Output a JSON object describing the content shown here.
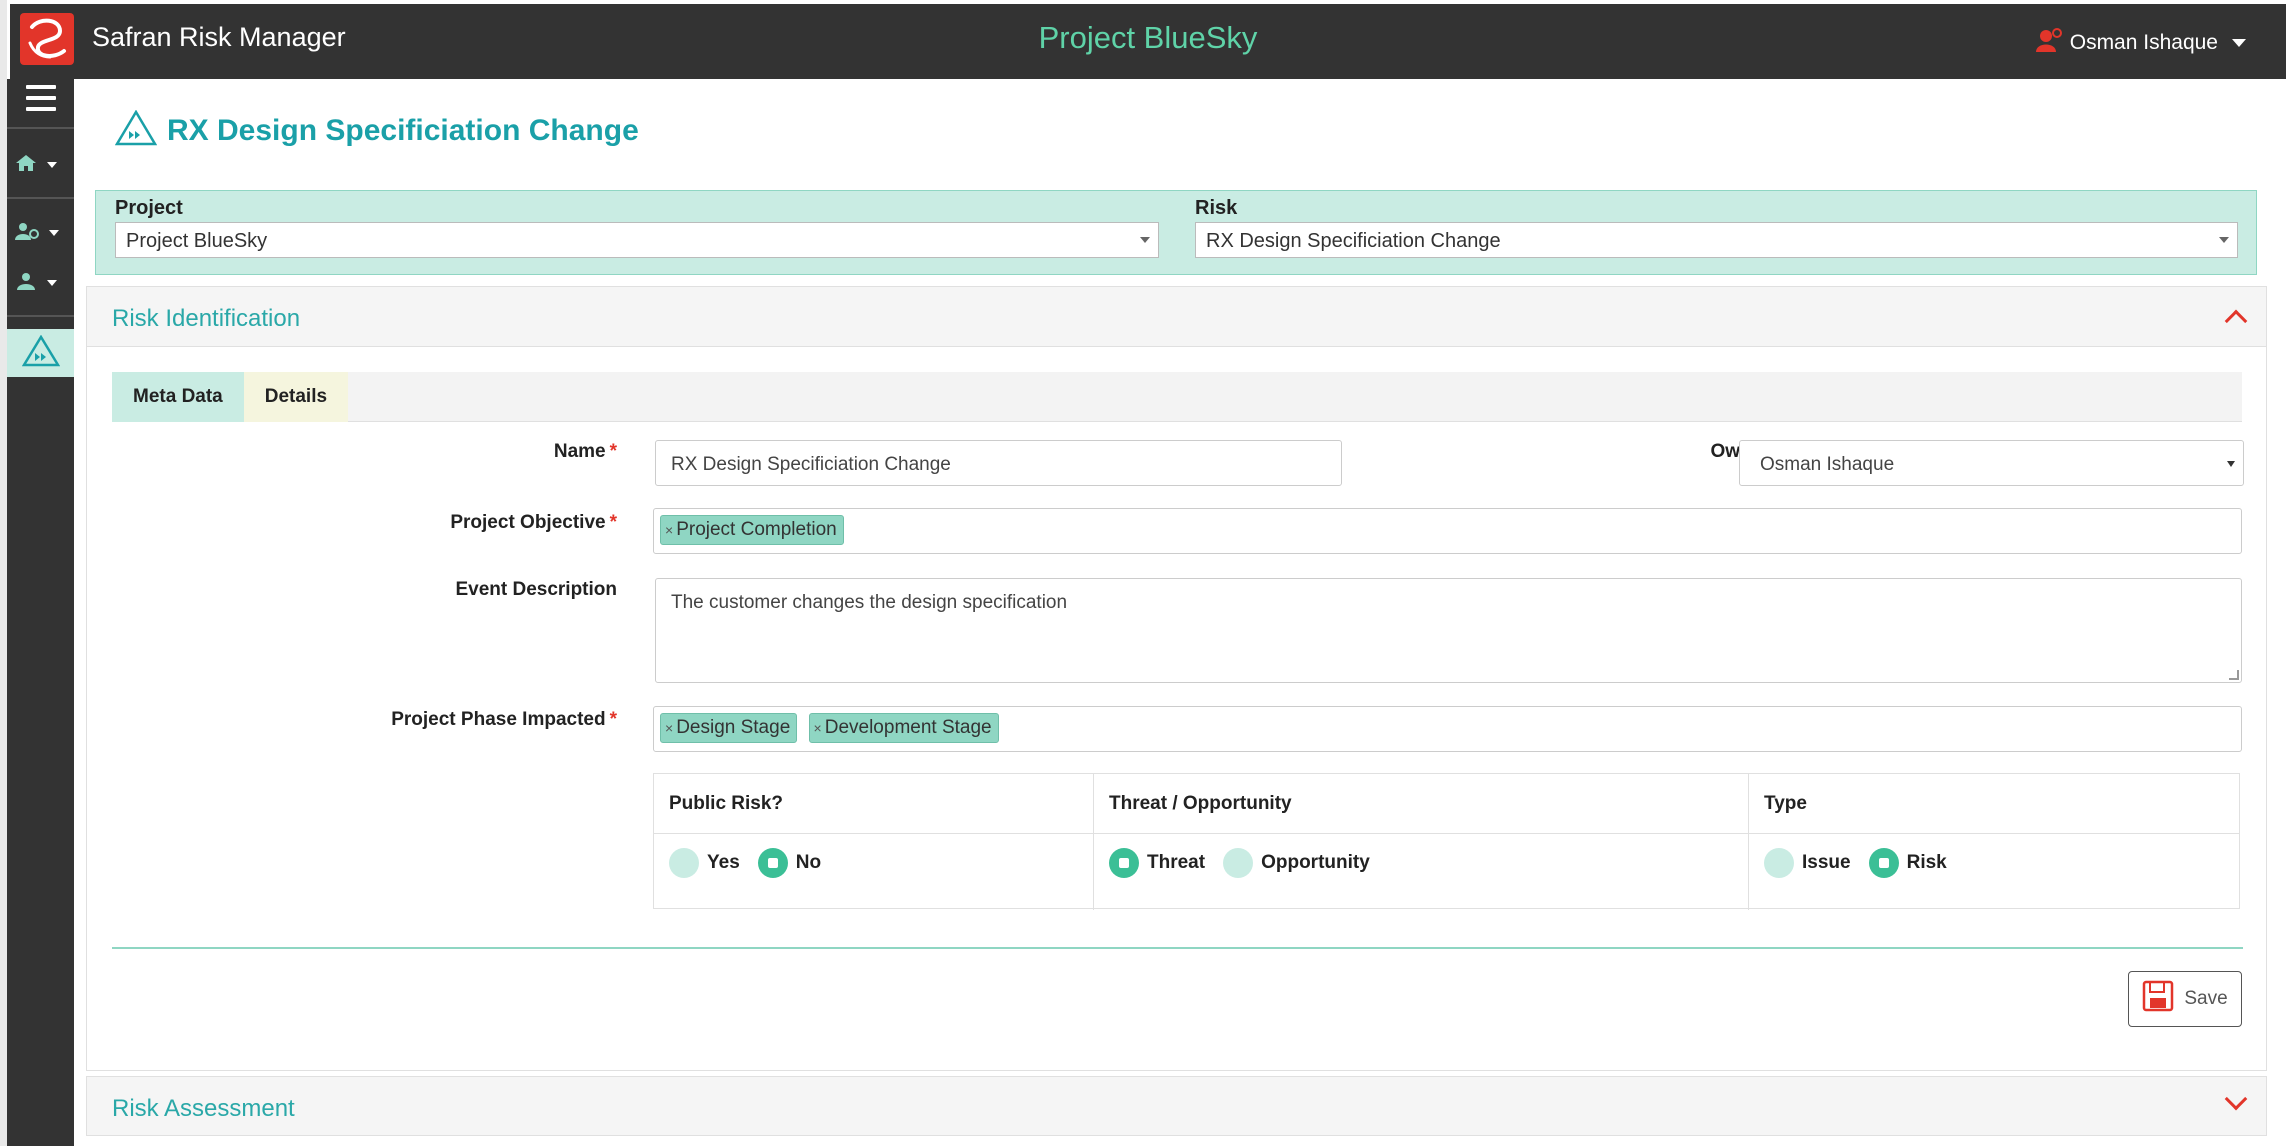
{
  "app": {
    "brand": "Safran Risk Manager",
    "project_title": "Project BlueSky",
    "user_name": "Osman Ishaque"
  },
  "page": {
    "title": "RX Design Specificiation Change"
  },
  "selectors": {
    "project": {
      "label": "Project",
      "value": "Project BlueSky"
    },
    "risk": {
      "label": "Risk",
      "value": "RX Design Specificiation Change"
    }
  },
  "panels": {
    "identification_title": "Risk Identification",
    "assessment_title": "Risk Assessment"
  },
  "tabs": [
    {
      "label": "Meta Data"
    },
    {
      "label": "Details"
    }
  ],
  "form": {
    "name": {
      "label": "Name",
      "value": "RX Design Specificiation Change"
    },
    "owner": {
      "label": "Owner",
      "value": "Osman Ishaque"
    },
    "objective": {
      "label": "Project Objective",
      "tags": [
        "Project Completion"
      ]
    },
    "event": {
      "label": "Event Description",
      "value": "The customer changes the design specification"
    },
    "phase": {
      "label": "Project Phase Impacted",
      "tags": [
        "Design Stage",
        "Development Stage"
      ]
    },
    "required_mark": "*"
  },
  "options": {
    "public": {
      "header": "Public Risk?",
      "choices": [
        "Yes",
        "No"
      ],
      "selected": "No"
    },
    "threat": {
      "header": "Threat / Opportunity",
      "choices": [
        "Threat",
        "Opportunity"
      ],
      "selected": "Threat"
    },
    "type": {
      "header": "Type",
      "choices": [
        "Issue",
        "Risk"
      ],
      "selected": "Risk"
    }
  },
  "actions": {
    "save_label": "Save"
  },
  "colors": {
    "accent": "#1aa0a8",
    "teal_light": "#c9ece3",
    "brand_red": "#e2352a",
    "topbar": "#333333"
  }
}
